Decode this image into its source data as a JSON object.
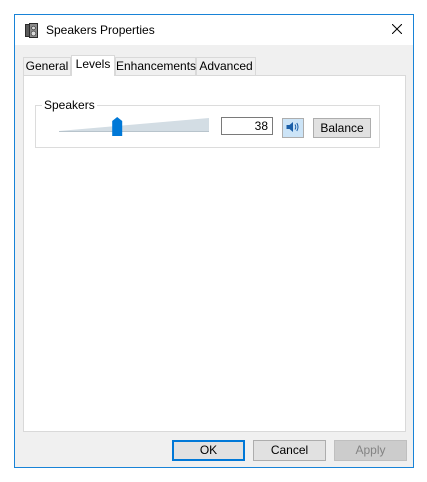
{
  "window": {
    "title": "Speakers Properties",
    "accent_color": "#1883d7"
  },
  "tabs": [
    {
      "label": "General",
      "active": false
    },
    {
      "label": "Levels",
      "active": true
    },
    {
      "label": "Enhancements",
      "active": false
    },
    {
      "label": "Advanced",
      "active": false
    }
  ],
  "levels": {
    "group_label": "Speakers",
    "volume_value": "38",
    "volume_fraction": 0.38,
    "slider_thumb_color": "#0078d7",
    "mute_icon": "speaker-volume-icon",
    "balance_label": "Balance"
  },
  "footer": {
    "ok_label": "OK",
    "cancel_label": "Cancel",
    "apply_label": "Apply"
  },
  "icons": {
    "title": "speaker-properties-icon",
    "close": "close-icon"
  }
}
